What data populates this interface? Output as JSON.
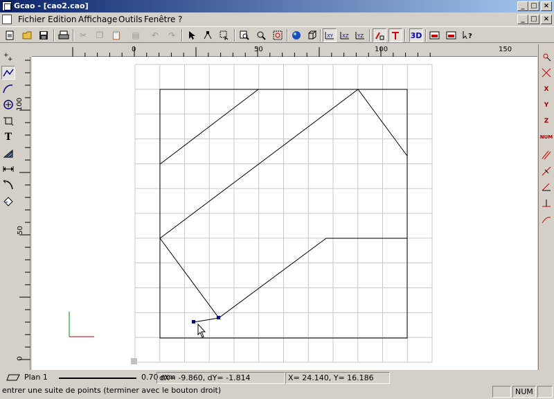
{
  "window": {
    "title": "Gcao - [cao2.cao]"
  },
  "menu": {
    "items": [
      {
        "label": "Fichier"
      },
      {
        "label": "Edition"
      },
      {
        "label": "Affichage"
      },
      {
        "label": "Outils"
      },
      {
        "label": "Fenêtre"
      },
      {
        "label": "?"
      }
    ]
  },
  "toolbar": {
    "view_3d_label": "3D"
  },
  "ruler": {
    "horizontal_ticks": [
      "0",
      "50",
      "100",
      "150"
    ],
    "vertical_ticks": [
      "100",
      "50",
      "0"
    ]
  },
  "left_tools": {
    "text_tool_label": "T"
  },
  "right_tools": {
    "x_label": "X",
    "y_label": "Y",
    "z_label": "Z",
    "num_label": "NUM"
  },
  "status": {
    "layer": "Plan 1",
    "line_width": "0.70 mm",
    "delta": "dX=   -9.860, dY=   -1.814",
    "coords": "X=   24.140, Y=   16.186",
    "prompt": "entrer une suite de points (terminer avec le bouton droit)",
    "num_indicator": "NUM"
  }
}
